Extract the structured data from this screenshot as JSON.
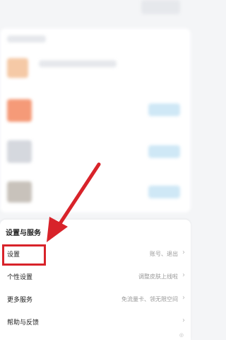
{
  "menu": {
    "section_title": "设置与服务",
    "items": [
      {
        "label": "设置",
        "value": "账号、退出",
        "chevron": "›"
      },
      {
        "label": "个性设置",
        "value": "调整皮肤上线啦",
        "chevron": "›"
      },
      {
        "label": "更多服务",
        "value": "免流量卡、领无限空间",
        "chevron": "›"
      },
      {
        "label": "帮助与反馈",
        "value": "",
        "chevron": "›"
      }
    ]
  },
  "colors": {
    "highlight": "#d8232a",
    "arrow": "#d8232a",
    "blur_orange": "#f59a78",
    "blur_blue": "#cfe8f6"
  }
}
